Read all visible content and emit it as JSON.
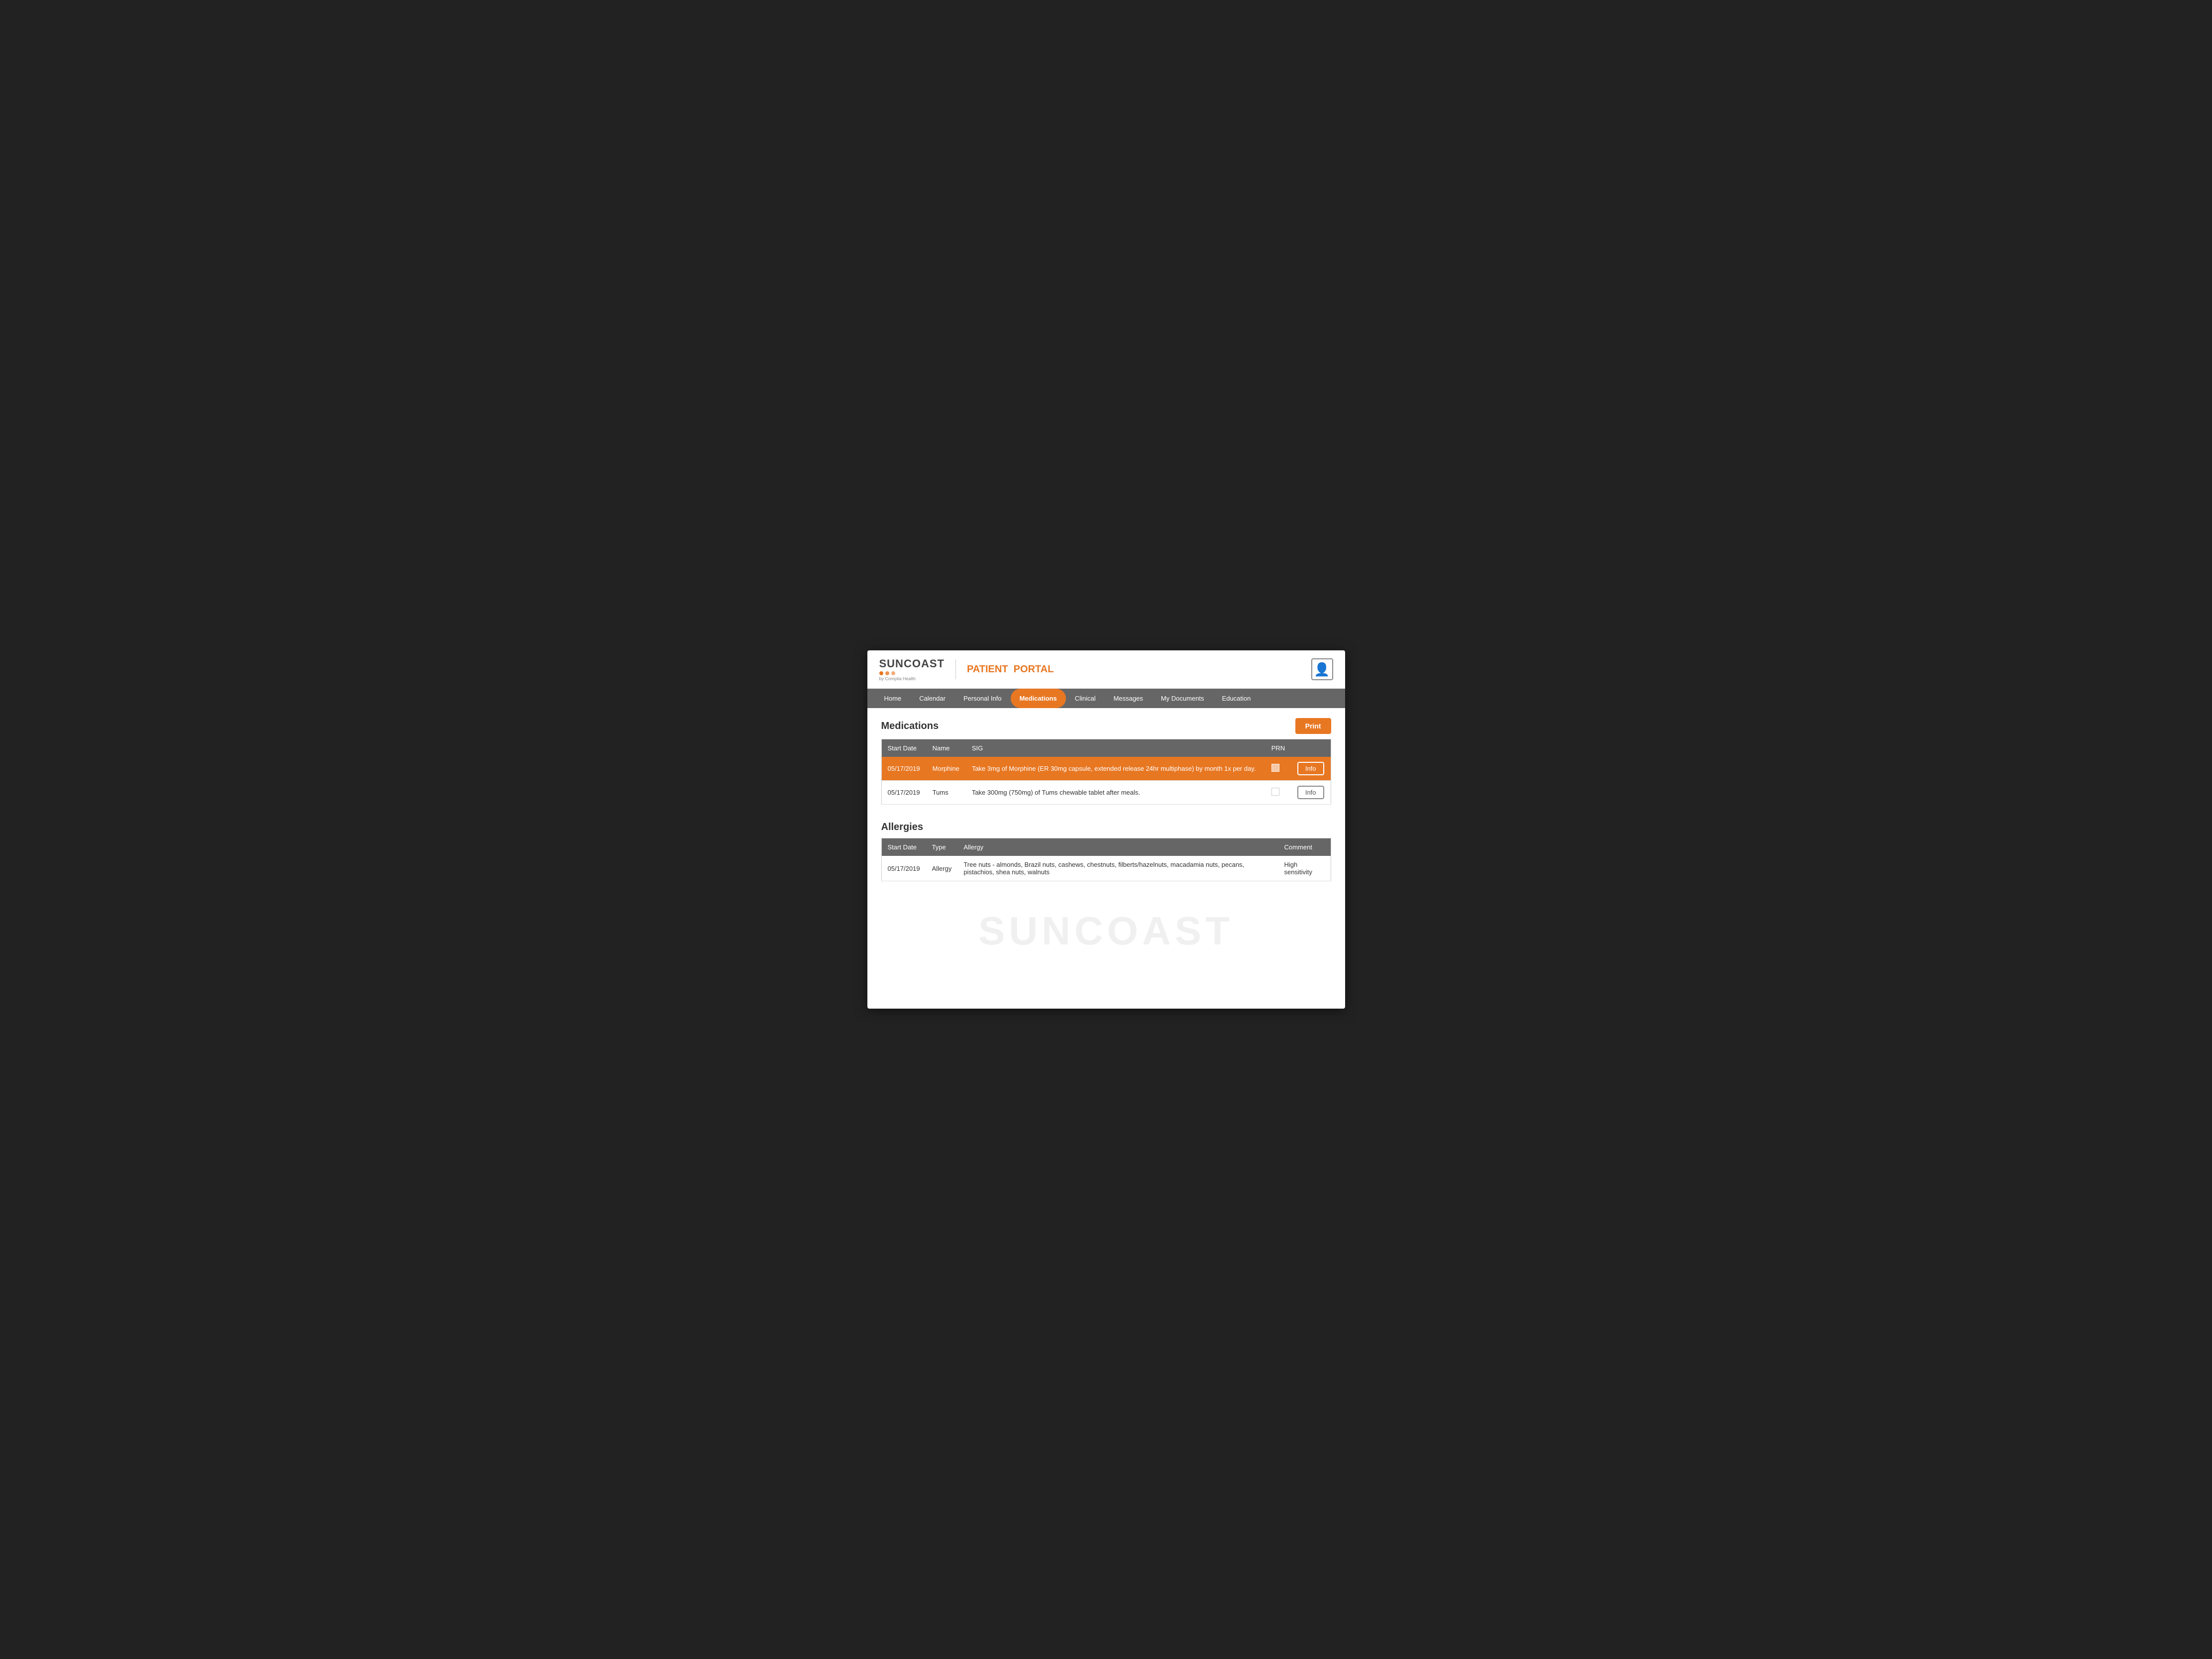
{
  "brand": {
    "name": "SUNCOAST",
    "byline": "by Complia Health",
    "portal_label": "PATIENT",
    "portal_highlight": "PORTAL"
  },
  "header": {
    "avatar_label": "User Avatar"
  },
  "nav": {
    "items": [
      {
        "label": "Home",
        "active": false
      },
      {
        "label": "Calendar",
        "active": false
      },
      {
        "label": "Personal Info",
        "active": false
      },
      {
        "label": "Medications",
        "active": true
      },
      {
        "label": "Clinical",
        "active": false
      },
      {
        "label": "Messages",
        "active": false
      },
      {
        "label": "My Documents",
        "active": false
      },
      {
        "label": "Education",
        "active": false
      }
    ]
  },
  "medications": {
    "section_title": "Medications",
    "print_label": "Print",
    "columns": [
      "Start Date",
      "Name",
      "SIG",
      "PRN",
      ""
    ],
    "rows": [
      {
        "start_date": "05/17/2019",
        "name": "Morphine",
        "sig": "Take 3mg of Morphine (ER 30mg capsule, extended release 24hr multiphase) by month 1x per day.",
        "prn": false,
        "info_label": "Info",
        "highlighted": true
      },
      {
        "start_date": "05/17/2019",
        "name": "Tums",
        "sig": "Take 300mg (750mg) of Tums chewable tablet after meals.",
        "prn": false,
        "info_label": "Info",
        "highlighted": false
      }
    ]
  },
  "allergies": {
    "section_title": "Allergies",
    "columns": [
      "Start Date",
      "Type",
      "Allergy",
      "Comment"
    ],
    "rows": [
      {
        "start_date": "05/17/2019",
        "type": "Allergy",
        "allergy": "Tree nuts - almonds, Brazil nuts, cashews, chestnuts, filberts/hazelnuts, macadamia nuts, pecans, pistachios, shea nuts, walnuts",
        "comment": "High sensitivity"
      }
    ]
  },
  "watermark": "SUNCOAST"
}
